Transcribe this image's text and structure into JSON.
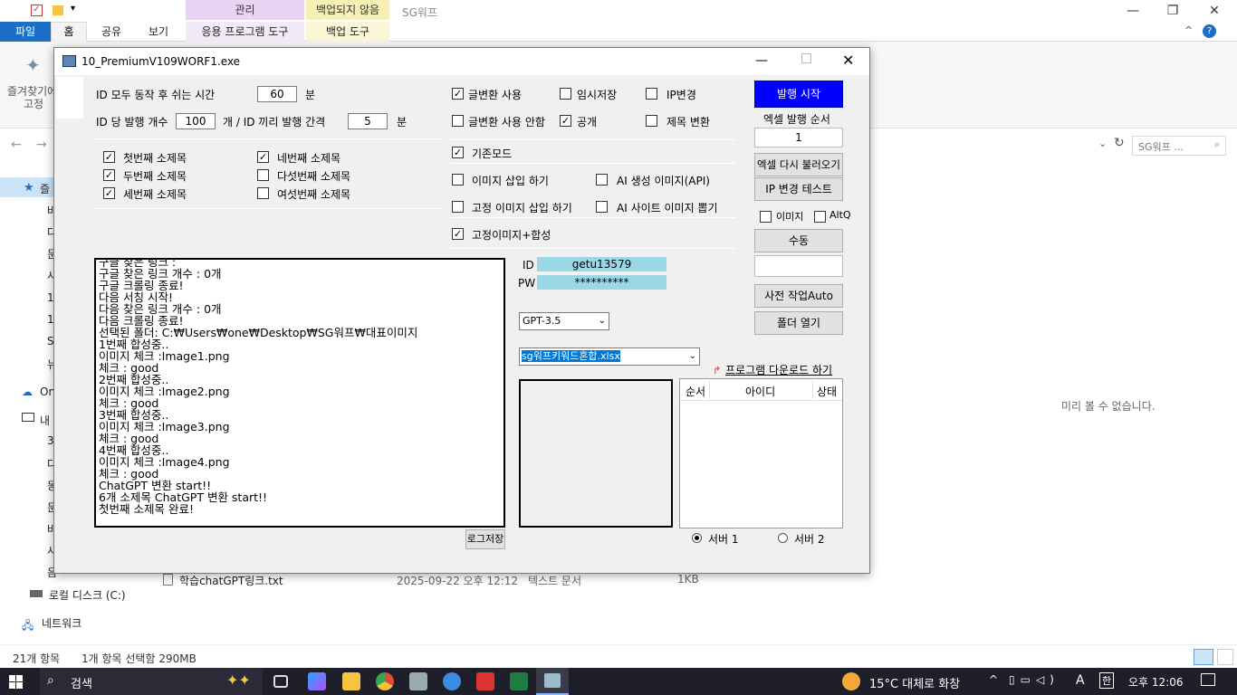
{
  "explorer": {
    "quick_access_icons": [
      "checkbox-icon",
      "folder-icon",
      "dropdown-icon"
    ],
    "context_tabs": {
      "manage": "관리",
      "backup_status": "백업되지 않음"
    },
    "window_title": "SG워프",
    "tabs": {
      "file": "파일",
      "home": "홈",
      "share": "공유",
      "view": "보기",
      "app_tools": "응용 프로그램 도구",
      "backup_tools": "백업 도구"
    },
    "ribbon": {
      "pin_label_1": "즐겨찾기에",
      "pin_label_2": "고정"
    },
    "search_placeholder": "SG워프 ...",
    "nav_items": [
      "즐",
      "바",
      "다",
      "문",
      "사",
      "1",
      "1",
      "S",
      "뉴",
      "On",
      "내",
      "3",
      "다",
      "동",
      "문",
      "바",
      "사",
      "음",
      "로컬 디스크 (C:)",
      "네트워크"
    ],
    "file_row": {
      "name": "학습chatGPT링크.txt",
      "date": "2025-09-22 오후 12:12",
      "type": "텍스트 문서",
      "size": "1KB"
    },
    "preview_message": "미리 볼 수 없습니다.",
    "status": {
      "count": "21개 항목",
      "selected": "1개 항목 선택함 290MB"
    }
  },
  "app": {
    "title": "10_PremiumV109WORF1.exe",
    "rest_time_label": "ID 모두 동작 후 쉬는 시간",
    "rest_time_value": "60",
    "rest_time_unit": "분",
    "posts_per_id_label": "ID 당 발행 개수",
    "posts_per_id_value": "100",
    "interval_label": "개 /  ID 끼리 발행 간격",
    "interval_value": "5",
    "interval_unit": "분",
    "options": {
      "text_convert": "글변환 사용",
      "temp_save": "임시저장",
      "ip_change": "IP변경",
      "no_text_convert": "글변환 사용 안함",
      "public": "공개",
      "title_change": "제목 변환"
    },
    "subtitles": [
      "첫번째 소제목",
      "두번째 소제목",
      "세번째 소제목",
      "네번째 소제목",
      "다섯번째 소제목",
      "여섯번째 소제목"
    ],
    "modes": {
      "basic": "기존모드",
      "insert_image": "이미지 삽입 하기",
      "ai_image": "AI 생성 이미지(API)",
      "fixed_image": "고정 이미지 삽입 하기",
      "ai_site_image": "AI 사이트 이미지 뽑기",
      "fixed_compose": "고정이미지+합성"
    },
    "buttons": {
      "start": "발행 시작",
      "excel_order": "엑셀 발행 순서",
      "reload_excel": "엑셀 다시 불러오기",
      "ip_test": "IP 변경 테스트",
      "manual": "수동",
      "pre_work": "사전 작업Auto",
      "open_folder": "폴더 열기",
      "save_log": "로그저장"
    },
    "excel_order_value": "1",
    "image_label": "이미지",
    "altq_label": "AltQ",
    "id_label": "ID",
    "id_value": "getu13579",
    "pw_label": "PW",
    "pw_value": "**********",
    "model_select": "GPT-3.5",
    "file_select": "sg워프키워드혼합.xlsx",
    "download_link": "프로그램 다운로드 하기",
    "table_headers": [
      "순서",
      "아이디",
      "상태"
    ],
    "server1": "서버 1",
    "server2": "서버 2",
    "log_lines": [
      "구글 찾은 링크 :",
      "구글 찾은 링크 개수 : 0개",
      "구글 크롤링 종료!",
      "다음 서칭 시작!",
      "다음 찾은 링크 개수 : 0개",
      "다음 크롤링 종료!",
      "선택된 폴더: C:₩Users₩one₩Desktop₩SG워프₩대표이미지",
      "1번째 합성중..",
      "이미지 체크 :Image1.png",
      "체크 : good",
      "2번째 합성중..",
      "이미지 체크 :Image2.png",
      "체크 : good",
      "3번째 합성중..",
      "이미지 체크 :Image3.png",
      "체크 : good",
      "4번째 합성중..",
      "이미지 체크 :Image4.png",
      "체크 : good",
      "ChatGPT 변환 start!!",
      "6개 소제목 ChatGPT 변환 start!!",
      "첫번째 소제목 완료!"
    ]
  },
  "taskbar": {
    "search": "검색",
    "weather": "15°C  대체로 화창",
    "time": "오후 12:06",
    "ime": "A"
  },
  "colors": {
    "start_button": "#0000ff",
    "credential_bg": "#9ad8e6",
    "file_tab": "#1c6fc6"
  }
}
